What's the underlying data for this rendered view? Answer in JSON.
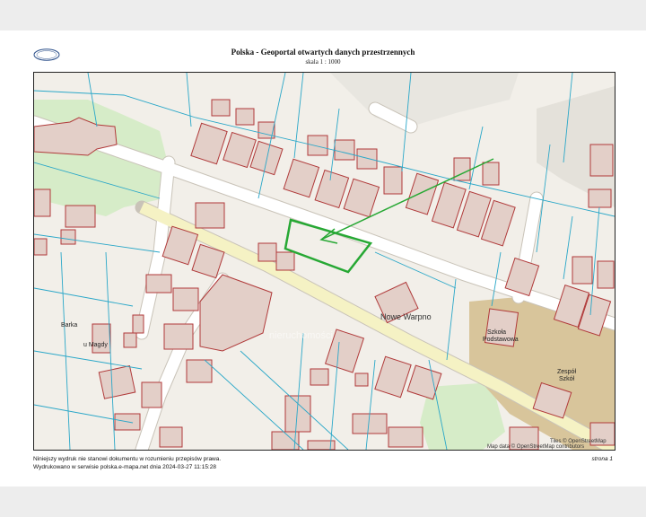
{
  "header": {
    "logo_text": "GEOPORTAL",
    "title": "Polska - Geoportal otwartych danych przestrzennych",
    "scale": "skala 1 : 1000"
  },
  "map": {
    "labels": {
      "town": "Nowe Warpno",
      "school1": "Szkoła",
      "school2": "Podstawowa",
      "complex1": "Zespół",
      "complex2": "Szkół",
      "barka": "Barka",
      "magda": "u Magdy",
      "watermark": "nieruchomości"
    },
    "attribution1": "Tiles © OpenStreetMap",
    "attribution2": "Map data © OpenStreetMap contributors",
    "colors": {
      "background": "#f2efe9",
      "building_fill": "#e3cfc8",
      "building_stroke": "#b03a3a",
      "parcel": "#2aa7c8",
      "road": "#ffffff",
      "main_road": "#f5f2c4",
      "highlight": "#27a834",
      "green": "#d6ecc8",
      "school_area": "#d8c59b"
    }
  },
  "footer": {
    "line1": "Niniejszy wydruk nie stanowi dokumentu w rozumieniu przepisów prawa.",
    "line2": "Wydrukowano w serwisie polska.e-mapa.net dnia 2024-03-27 11:15:28",
    "page": "strona 1"
  }
}
